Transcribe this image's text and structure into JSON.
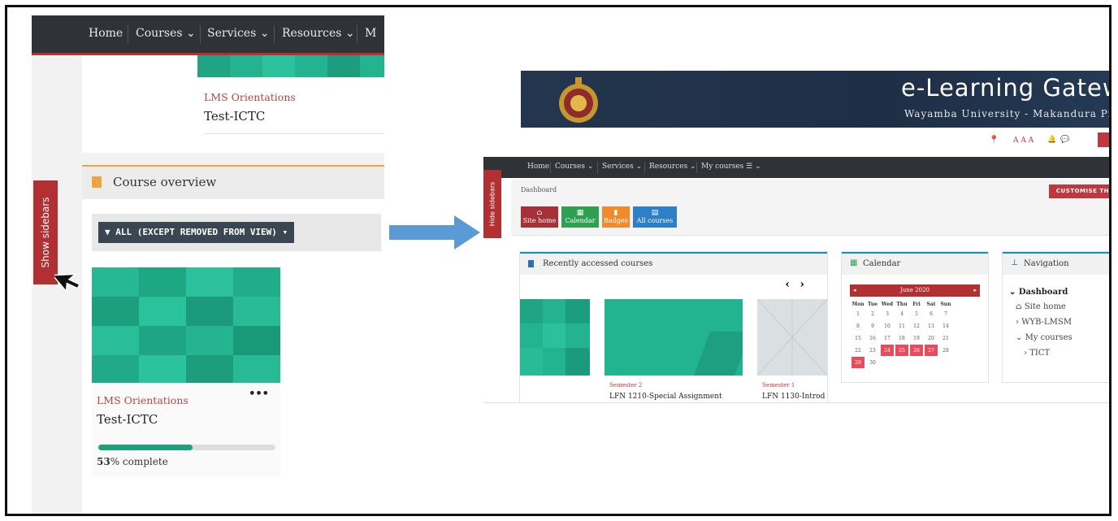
{
  "left_panel": {
    "nav": {
      "items": [
        "Home",
        "Courses ⌄",
        "Services ⌄",
        "Resources ⌄",
        "M"
      ]
    },
    "top_card": {
      "category": "LMS Orientations",
      "title": "Test-ICTC"
    },
    "sidebar_tab": "Show sidebars",
    "course_overview": {
      "title": "Course overview",
      "filter_label": "ALL (EXCEPT REMOVED FROM VIEW)",
      "card": {
        "category": "LMS Orientations",
        "title": "Test-ICTC",
        "more": "•••",
        "progress_percent": 53,
        "progress_num": "53",
        "progress_suffix": "% complete"
      }
    }
  },
  "right_panel": {
    "banner": {
      "title": "e-Learning Gatewa",
      "subtitle": "Wayamba University - Makandura Prem"
    },
    "top_icons": [
      "📍",
      "A A A",
      "🔔",
      "💬"
    ],
    "nav": {
      "items": [
        "Home",
        "Courses ⌄",
        "Services ⌄",
        "Resources ⌄",
        "My courses ☰ ⌄"
      ]
    },
    "hide_tab": "Hide sidebars",
    "breadcrumb": "Dashboard",
    "customise_button": "CUSTOMISE THI",
    "quick_buttons": [
      {
        "label": "Site home",
        "color": "#a53136"
      },
      {
        "label": "Calendar",
        "color": "#2f9f52"
      },
      {
        "label": "Badges",
        "color": "#f08a2b"
      },
      {
        "label": "All courses",
        "color": "#2d7fc7"
      }
    ],
    "recent": {
      "title": "Recently accessed courses",
      "prev": "‹",
      "next": "›",
      "courses": [
        {
          "semester": "Semester 2",
          "title": "LFN 1210-Special Assignment"
        },
        {
          "semester": "Semester 1",
          "title": "LFN 1130-Introd"
        }
      ]
    },
    "calendar": {
      "title": "Calendar",
      "month": "June 2020",
      "prev": "◂",
      "next": "▸",
      "weekdays": [
        "Mon",
        "Tue",
        "Wed",
        "Thu",
        "Fri",
        "Sat",
        "Sun"
      ],
      "weeks": [
        [
          "1",
          "2",
          "3",
          "4",
          "5",
          "6",
          "7"
        ],
        [
          "8",
          "9",
          "10",
          "11",
          "12",
          "13",
          "14"
        ],
        [
          "15",
          "16",
          "17",
          "18",
          "19",
          "20",
          "21"
        ],
        [
          "22",
          "23",
          "24",
          "25",
          "26",
          "27",
          "28"
        ],
        [
          "29",
          "30",
          "",
          "",
          "",
          "",
          ""
        ]
      ],
      "event_days": [
        "24",
        "25",
        "26",
        "27",
        "29"
      ]
    },
    "navigation": {
      "title": "Navigation",
      "items": [
        "Dashboard",
        "Site home",
        "WYB-LMSM",
        "My courses",
        "TICT"
      ]
    }
  },
  "colors": {
    "dark_nav": "#2f3338",
    "accent_red": "#b22f32",
    "teal": "#23b38f",
    "arrow_blue": "#5b9bd5"
  }
}
